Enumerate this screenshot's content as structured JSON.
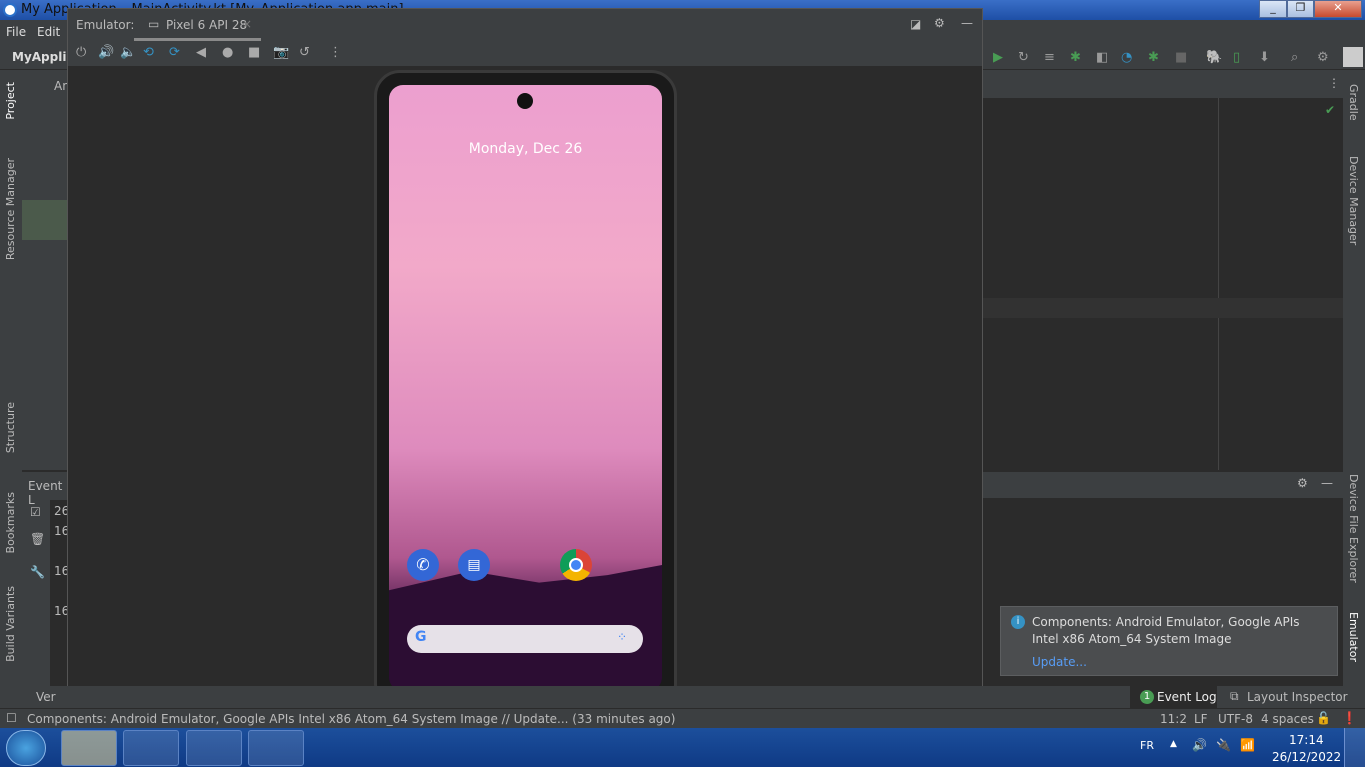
{
  "window": {
    "title": "My Application – MainActivity.kt [My_Application.app.main]",
    "min": "_",
    "max": "❐",
    "close": "✕"
  },
  "menu": [
    "File",
    "Edit"
  ],
  "project_name": "MyApplica",
  "left_stripe": [
    "Project",
    "Resource Manager",
    "Structure",
    "Bookmarks",
    "Build Variants"
  ],
  "right_stripe": [
    "Gradle",
    "Device Manager",
    "Device File Explorer",
    "Emulator"
  ],
  "emulator": {
    "label": "Emulator:",
    "tab": "Pixel 6 API 28",
    "tab_close": "×",
    "tools": [
      "power-icon",
      "volume-up-icon",
      "volume-down-icon",
      "rotate-left-icon",
      "rotate-right-icon",
      "back-icon",
      "home-icon",
      "overview-icon",
      "screenshot-icon",
      "snapshot-icon",
      "more-icon"
    ]
  },
  "phone": {
    "date": "Monday, Dec 26"
  },
  "event_log": {
    "title": "Event L",
    "rows": [
      "26",
      "16",
      "16",
      "16"
    ]
  },
  "project_root": "An",
  "notification": {
    "line1": "Components: Android Emulator, Google APIs",
    "line2": "Intel x86 Atom_64 System Image",
    "link": "Update..."
  },
  "bottom_tabs": {
    "version": "Ver",
    "event_log": "Event Log",
    "event_count": "1",
    "layout_inspector": "Layout Inspector"
  },
  "status": {
    "message": "Components: Android Emulator, Google APIs Intel x86 Atom_64 System Image // Update... (33 minutes ago)",
    "position": "11:2",
    "line_sep": "LF",
    "encoding": "UTF-8",
    "indent": "4 spaces"
  },
  "taskbar": {
    "lang": "FR",
    "time": "17:14",
    "date": "26/12/2022"
  },
  "colors": {
    "accent": "#589df6",
    "run": "#499c54",
    "ide_bg": "#2b2b2b",
    "panel": "#3c3f41"
  }
}
